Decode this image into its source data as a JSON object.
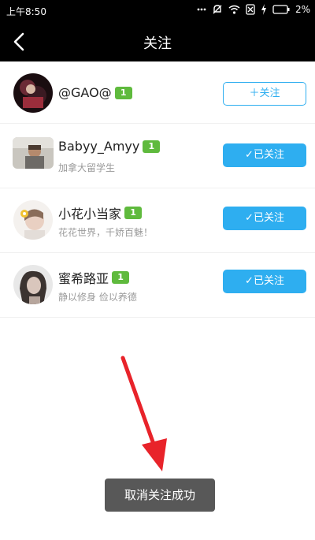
{
  "status_bar": {
    "time": "上午8:50",
    "battery": "2%",
    "icons": [
      "more-icon",
      "alarm-muted-icon",
      "wifi-icon",
      "sim-off-icon",
      "charging-icon",
      "battery-icon"
    ]
  },
  "header": {
    "title": "关注",
    "back_icon": "back-arrow-icon"
  },
  "users": [
    {
      "name": "@GAO@",
      "level": "1",
      "bio": "",
      "button_label": "＋关注",
      "following": false
    },
    {
      "name": "Babyy_Amyy",
      "level": "1",
      "bio": "加拿大留学生",
      "button_label": "✓已关注",
      "following": true
    },
    {
      "name": "小花小当家",
      "level": "1",
      "bio": "花花世界，千娇百魅！",
      "button_label": "✓已关注",
      "following": true
    },
    {
      "name": "蜜希路亚",
      "level": "1",
      "bio": "静以修身 俭以养德",
      "button_label": "✓已关注",
      "following": true
    }
  ],
  "toast": {
    "text": "取消关注成功"
  },
  "colors": {
    "accent": "#2eaef0",
    "level_badge": "#5fba3d",
    "toast_bg": "#585858",
    "annotation_arrow": "#e8232a"
  }
}
